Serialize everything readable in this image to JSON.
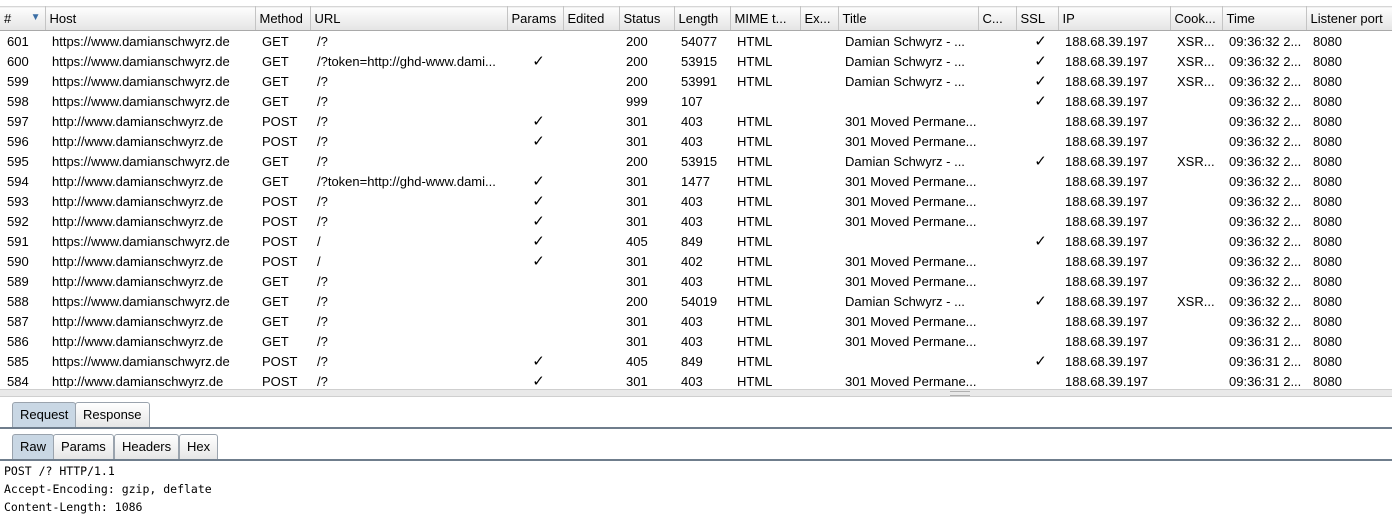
{
  "columns": [
    "#",
    "Host",
    "Method",
    "URL",
    "Params",
    "Edited",
    "Status",
    "Length",
    "MIME t...",
    "Ex...",
    "Title",
    "C...",
    "SSL",
    "IP",
    "Cook...",
    "Time",
    "Listener port"
  ],
  "rows": [
    {
      "num": "601",
      "host": "https://www.damianschwyrz.de",
      "method": "GET",
      "url": "/?",
      "params": "",
      "edited": "",
      "status": "200",
      "length": "54077",
      "mime": "HTML",
      "ext": "",
      "title": "Damian Schwyrz - ...",
      "comment": "",
      "ssl": "✓",
      "ip": "188.68.39.197",
      "cookies": "XSR...",
      "time": "09:36:32 2...",
      "port": "8080"
    },
    {
      "num": "600",
      "host": "https://www.damianschwyrz.de",
      "method": "GET",
      "url": "/?token=http://ghd-www.dami...",
      "params": "✓",
      "edited": "",
      "status": "200",
      "length": "53915",
      "mime": "HTML",
      "ext": "",
      "title": "Damian Schwyrz - ...",
      "comment": "",
      "ssl": "✓",
      "ip": "188.68.39.197",
      "cookies": "XSR...",
      "time": "09:36:32 2...",
      "port": "8080"
    },
    {
      "num": "599",
      "host": "https://www.damianschwyrz.de",
      "method": "GET",
      "url": "/?",
      "params": "",
      "edited": "",
      "status": "200",
      "length": "53991",
      "mime": "HTML",
      "ext": "",
      "title": "Damian Schwyrz - ...",
      "comment": "",
      "ssl": "✓",
      "ip": "188.68.39.197",
      "cookies": "XSR...",
      "time": "09:36:32 2...",
      "port": "8080"
    },
    {
      "num": "598",
      "host": "https://www.damianschwyrz.de",
      "method": "GET",
      "url": "/?",
      "params": "",
      "edited": "",
      "status": "999",
      "length": "107",
      "mime": "",
      "ext": "",
      "title": "",
      "comment": "",
      "ssl": "✓",
      "ip": "188.68.39.197",
      "cookies": "",
      "time": "09:36:32 2...",
      "port": "8080"
    },
    {
      "num": "597",
      "host": "http://www.damianschwyrz.de",
      "method": "POST",
      "url": "/?",
      "params": "✓",
      "edited": "",
      "status": "301",
      "length": "403",
      "mime": "HTML",
      "ext": "",
      "title": "301 Moved Permane...",
      "comment": "",
      "ssl": "",
      "ip": "188.68.39.197",
      "cookies": "",
      "time": "09:36:32 2...",
      "port": "8080"
    },
    {
      "num": "596",
      "host": "http://www.damianschwyrz.de",
      "method": "POST",
      "url": "/?",
      "params": "✓",
      "edited": "",
      "status": "301",
      "length": "403",
      "mime": "HTML",
      "ext": "",
      "title": "301 Moved Permane...",
      "comment": "",
      "ssl": "",
      "ip": "188.68.39.197",
      "cookies": "",
      "time": "09:36:32 2...",
      "port": "8080"
    },
    {
      "num": "595",
      "host": "https://www.damianschwyrz.de",
      "method": "GET",
      "url": "/?",
      "params": "",
      "edited": "",
      "status": "200",
      "length": "53915",
      "mime": "HTML",
      "ext": "",
      "title": "Damian Schwyrz - ...",
      "comment": "",
      "ssl": "✓",
      "ip": "188.68.39.197",
      "cookies": "XSR...",
      "time": "09:36:32 2...",
      "port": "8080"
    },
    {
      "num": "594",
      "host": "http://www.damianschwyrz.de",
      "method": "GET",
      "url": "/?token=http://ghd-www.dami...",
      "params": "✓",
      "edited": "",
      "status": "301",
      "length": "1477",
      "mime": "HTML",
      "ext": "",
      "title": "301 Moved Permane...",
      "comment": "",
      "ssl": "",
      "ip": "188.68.39.197",
      "cookies": "",
      "time": "09:36:32 2...",
      "port": "8080"
    },
    {
      "num": "593",
      "host": "http://www.damianschwyrz.de",
      "method": "POST",
      "url": "/?",
      "params": "✓",
      "edited": "",
      "status": "301",
      "length": "403",
      "mime": "HTML",
      "ext": "",
      "title": "301 Moved Permane...",
      "comment": "",
      "ssl": "",
      "ip": "188.68.39.197",
      "cookies": "",
      "time": "09:36:32 2...",
      "port": "8080"
    },
    {
      "num": "592",
      "host": "http://www.damianschwyrz.de",
      "method": "POST",
      "url": "/?",
      "params": "✓",
      "edited": "",
      "status": "301",
      "length": "403",
      "mime": "HTML",
      "ext": "",
      "title": "301 Moved Permane...",
      "comment": "",
      "ssl": "",
      "ip": "188.68.39.197",
      "cookies": "",
      "time": "09:36:32 2...",
      "port": "8080"
    },
    {
      "num": "591",
      "host": "https://www.damianschwyrz.de",
      "method": "POST",
      "url": "/",
      "params": "✓",
      "edited": "",
      "status": "405",
      "length": "849",
      "mime": "HTML",
      "ext": "",
      "title": "",
      "comment": "",
      "ssl": "✓",
      "ip": "188.68.39.197",
      "cookies": "",
      "time": "09:36:32 2...",
      "port": "8080"
    },
    {
      "num": "590",
      "host": "http://www.damianschwyrz.de",
      "method": "POST",
      "url": "/",
      "params": "✓",
      "edited": "",
      "status": "301",
      "length": "402",
      "mime": "HTML",
      "ext": "",
      "title": "301 Moved Permane...",
      "comment": "",
      "ssl": "",
      "ip": "188.68.39.197",
      "cookies": "",
      "time": "09:36:32 2...",
      "port": "8080"
    },
    {
      "num": "589",
      "host": "http://www.damianschwyrz.de",
      "method": "GET",
      "url": "/?",
      "params": "",
      "edited": "",
      "status": "301",
      "length": "403",
      "mime": "HTML",
      "ext": "",
      "title": "301 Moved Permane...",
      "comment": "",
      "ssl": "",
      "ip": "188.68.39.197",
      "cookies": "",
      "time": "09:36:32 2...",
      "port": "8080"
    },
    {
      "num": "588",
      "host": "https://www.damianschwyrz.de",
      "method": "GET",
      "url": "/?",
      "params": "",
      "edited": "",
      "status": "200",
      "length": "54019",
      "mime": "HTML",
      "ext": "",
      "title": "Damian Schwyrz - ...",
      "comment": "",
      "ssl": "✓",
      "ip": "188.68.39.197",
      "cookies": "XSR...",
      "time": "09:36:32 2...",
      "port": "8080"
    },
    {
      "num": "587",
      "host": "http://www.damianschwyrz.de",
      "method": "GET",
      "url": "/?",
      "params": "",
      "edited": "",
      "status": "301",
      "length": "403",
      "mime": "HTML",
      "ext": "",
      "title": "301 Moved Permane...",
      "comment": "",
      "ssl": "",
      "ip": "188.68.39.197",
      "cookies": "",
      "time": "09:36:32 2...",
      "port": "8080"
    },
    {
      "num": "586",
      "host": "http://www.damianschwyrz.de",
      "method": "GET",
      "url": "/?",
      "params": "",
      "edited": "",
      "status": "301",
      "length": "403",
      "mime": "HTML",
      "ext": "",
      "title": "301 Moved Permane...",
      "comment": "",
      "ssl": "",
      "ip": "188.68.39.197",
      "cookies": "",
      "time": "09:36:31 2...",
      "port": "8080"
    },
    {
      "num": "585",
      "host": "https://www.damianschwyrz.de",
      "method": "POST",
      "url": "/?",
      "params": "✓",
      "edited": "",
      "status": "405",
      "length": "849",
      "mime": "HTML",
      "ext": "",
      "title": "",
      "comment": "",
      "ssl": "✓",
      "ip": "188.68.39.197",
      "cookies": "",
      "time": "09:36:31 2...",
      "port": "8080"
    },
    {
      "num": "584",
      "host": "http://www.damianschwyrz.de",
      "method": "POST",
      "url": "/?",
      "params": "✓",
      "edited": "",
      "status": "301",
      "length": "403",
      "mime": "HTML",
      "ext": "",
      "title": "301 Moved Permane...",
      "comment": "",
      "ssl": "",
      "ip": "188.68.39.197",
      "cookies": "",
      "time": "09:36:31 2...",
      "port": "8080"
    }
  ],
  "main_tabs": [
    "Request",
    "Response"
  ],
  "sub_tabs": [
    "Raw",
    "Params",
    "Headers",
    "Hex"
  ],
  "raw_lines": [
    "POST /? HTTP/1.1",
    "Accept-Encoding: gzip, deflate",
    "Content-Length: 1086"
  ],
  "colors": {
    "active_tab": "#c9d7e4",
    "sort_arrow": "#3a6ea5",
    "tab_border": "#6f7d8c"
  },
  "icons": {
    "sort": "sort-descending-icon",
    "check": "checkmark-icon"
  }
}
